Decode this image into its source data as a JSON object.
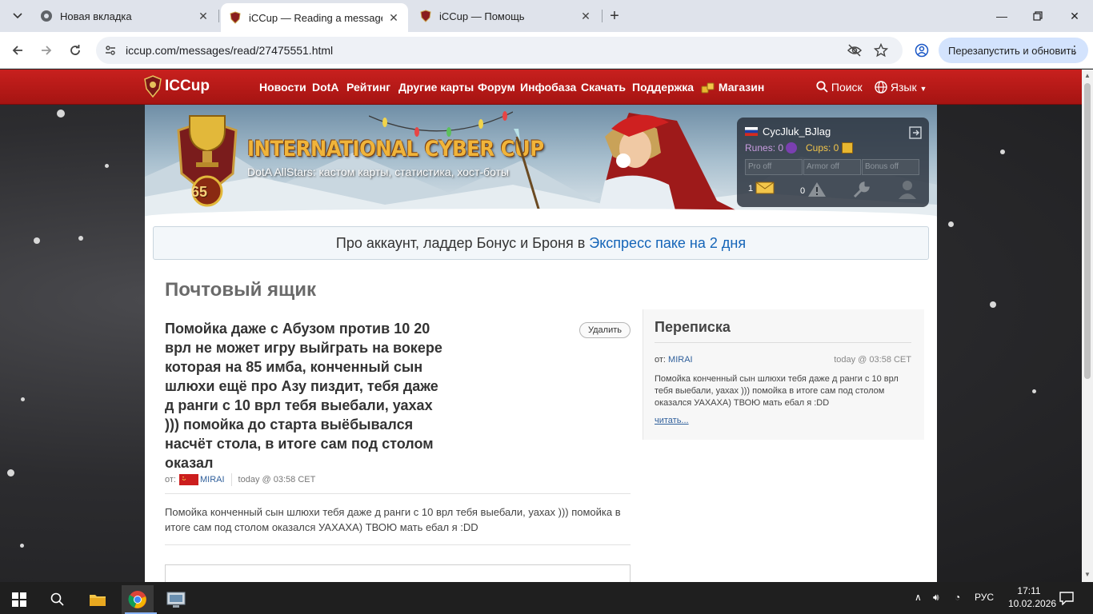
{
  "browser": {
    "tabs": [
      {
        "title": "Новая вкладка",
        "active": false
      },
      {
        "title": "iCCup — Reading a message fr",
        "active": true
      },
      {
        "title": "iCCup — Помощь",
        "active": false
      }
    ],
    "url": "iccup.com/messages/read/27475551.html",
    "relaunch_label": "Перезапустить и обновить"
  },
  "site": {
    "logo": "ICCup",
    "nav": [
      "Новости",
      "DotA",
      "Рейтинг",
      "Другие карты",
      "Форум",
      "Инфобаза",
      "Скачать",
      "Поддержка",
      "Магазин"
    ],
    "search_label": "Поиск",
    "language_label": "Язык",
    "banner": {
      "title": "INTERNATIONAL CYBER CUP",
      "subtitle": "DotA AllStars: кастом карты, статистика, хост-боты",
      "level": "65"
    },
    "user": {
      "name": "CycJluk_BJlag",
      "runes": "Runes: 0",
      "cups": "Cups: 0",
      "slots": [
        "Pro off",
        "Armor off",
        "Bonus off"
      ],
      "mail_count": "1",
      "warn_count": "0"
    },
    "promo": {
      "text": "Про аккаунт, ладдер Бонус и Броня в",
      "link": "Экспресс паке на 2 дня"
    }
  },
  "mailbox": {
    "title": "Почтовый ящик",
    "delete_label": "Удалить",
    "message": {
      "subject": "Помойка даже с Абузом против 10 20 врл не может игру выйграть на вокере которая на 85 имба, конченный сын шлюхи ещё про Азу пиздит, тебя даже д ранги с 10 врл тебя выебали, уахах ))) помойка до старта выёбывался насчёт стола, в итоге сам под столом оказал",
      "from_label": "от:",
      "sender": "MIRAI",
      "time": "today @ 03:58 CET",
      "body": "Помойка конченный сын шлюхи тебя даже д ранги с 10 врл тебя выебали, уахах ))) помойка в итоге сам под столом оказался УАХАХА) ТВОЮ мать ебал я :DD"
    }
  },
  "correspondence": {
    "title": "Переписка",
    "from_label": "от:",
    "sender": "MIRAI",
    "time": "today @ 03:58 CET",
    "body": "Помойка конченный сын шлюхи тебя даже д ранги с 10 врл тебя выебали, уахах ))) помойка в итоге сам под столом оказался УАХАХА) ТВОЮ мать ебал я :DD",
    "read_label": "читать..."
  },
  "taskbar": {
    "lang": "РУС",
    "time": "17:11",
    "date": "10.02.2026"
  },
  "colors": {
    "nav_red": "#b5191a",
    "link_blue": "#1565b8",
    "chrome_tab_bg": "#dfe3eb"
  }
}
